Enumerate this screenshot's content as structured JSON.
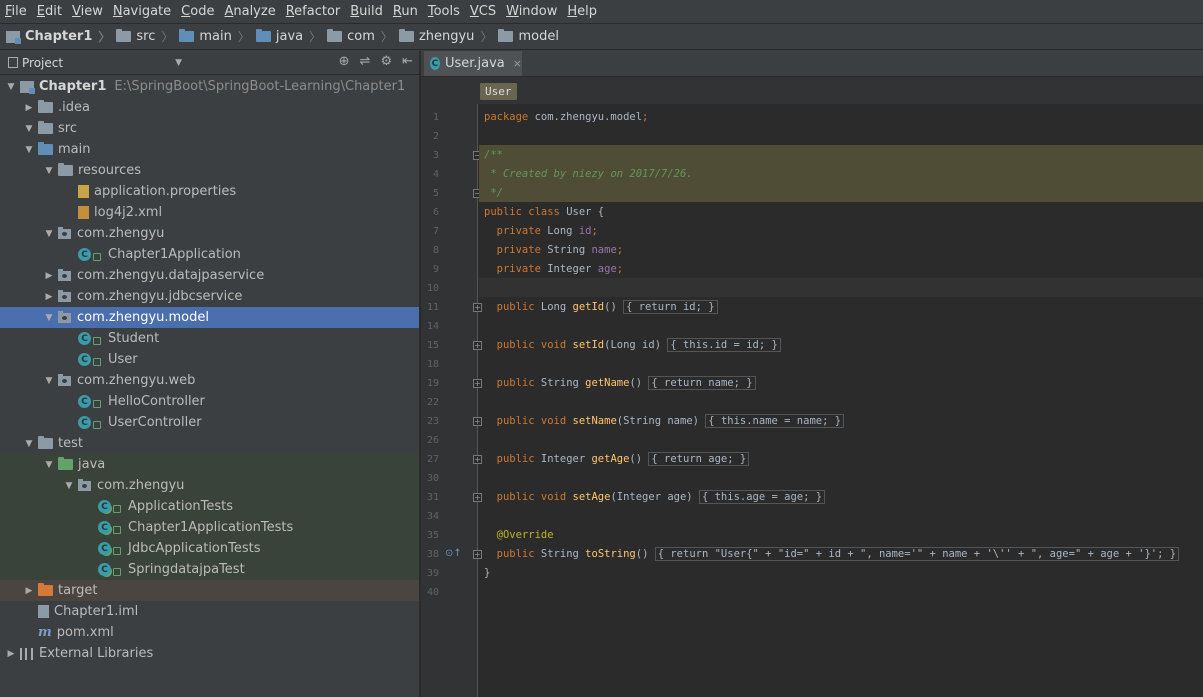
{
  "menu": [
    "File",
    "Edit",
    "View",
    "Navigate",
    "Code",
    "Analyze",
    "Refactor",
    "Build",
    "Run",
    "Tools",
    "VCS",
    "Window",
    "Help"
  ],
  "nav": {
    "items": [
      "Chapter1",
      "src",
      "main",
      "java",
      "com",
      "zhengyu",
      "model"
    ]
  },
  "project_panel": {
    "title": "Project",
    "tools": [
      "⊕",
      "⇌",
      "⚙",
      "⇤"
    ]
  },
  "tree": [
    {
      "label": "Chapter1",
      "path": "E:\\SpringBoot\\SpringBoot-Learning\\Chapter1",
      "icon": "module-icon",
      "depth": 0,
      "expanded": true,
      "bold": true
    },
    {
      "label": ".idea",
      "icon": "folder-icon",
      "depth": 1,
      "expanded": false
    },
    {
      "label": "src",
      "icon": "folder-icon",
      "depth": 1,
      "expanded": true
    },
    {
      "label": "main",
      "icon": "source-folder-icon",
      "depth": 2,
      "expanded": true
    },
    {
      "label": "resources",
      "icon": "resources-folder-icon",
      "depth": 3,
      "expanded": true
    },
    {
      "label": "application.properties",
      "icon": "properties-file-icon",
      "depth": 4,
      "expanded": null
    },
    {
      "label": "log4j2.xml",
      "icon": "xml-file-icon",
      "depth": 4,
      "expanded": null
    },
    {
      "label": "com.zhengyu",
      "icon": "package-icon",
      "depth": 3,
      "expanded": true
    },
    {
      "label": "Chapter1Application",
      "icon": "class-icon",
      "depth": 4,
      "expanded": null
    },
    {
      "label": "com.zhengyu.datajpaservice",
      "icon": "package-icon",
      "depth": 3,
      "expanded": false
    },
    {
      "label": "com.zhengyu.jdbcservice",
      "icon": "package-icon",
      "depth": 3,
      "expanded": false
    },
    {
      "label": "com.zhengyu.model",
      "icon": "package-icon",
      "depth": 3,
      "expanded": true,
      "selected": true
    },
    {
      "label": "Student",
      "icon": "class-icon",
      "depth": 4,
      "expanded": null
    },
    {
      "label": "User",
      "icon": "class-icon",
      "depth": 4,
      "expanded": null
    },
    {
      "label": "com.zhengyu.web",
      "icon": "package-icon",
      "depth": 3,
      "expanded": true
    },
    {
      "label": "HelloController",
      "icon": "class-icon",
      "depth": 4,
      "expanded": null
    },
    {
      "label": "UserController",
      "icon": "class-icon",
      "depth": 4,
      "expanded": null
    },
    {
      "label": "test",
      "icon": "folder-icon",
      "depth": 2,
      "expanded": true
    },
    {
      "label": "java",
      "icon": "test-folder-icon",
      "depth": 3,
      "expanded": true,
      "band": "test"
    },
    {
      "label": "com.zhengyu",
      "icon": "package-icon",
      "depth": 4,
      "expanded": true,
      "band": "test"
    },
    {
      "label": "ApplicationTests",
      "icon": "test-class-icon",
      "depth": 5,
      "expanded": null,
      "band": "test"
    },
    {
      "label": "Chapter1ApplicationTests",
      "icon": "test-class-icon",
      "depth": 5,
      "expanded": null,
      "band": "test"
    },
    {
      "label": "JdbcApplicationTests",
      "icon": "test-class-icon",
      "depth": 5,
      "expanded": null,
      "band": "test"
    },
    {
      "label": "SpringdatajpaTest",
      "icon": "test-class-icon",
      "depth": 5,
      "expanded": null,
      "band": "test"
    },
    {
      "label": "target",
      "icon": "excluded-folder-icon",
      "depth": 1,
      "expanded": false,
      "band": "excluded"
    },
    {
      "label": "Chapter1.iml",
      "icon": "iml-file-icon",
      "depth": 1,
      "expanded": null
    },
    {
      "label": "pom.xml",
      "icon": "maven-icon",
      "depth": 1,
      "expanded": null
    },
    {
      "label": "External Libraries",
      "icon": "library-icon",
      "depth": 0,
      "expanded": false
    }
  ],
  "editor": {
    "tab_label": "User.java",
    "tab_close": "×",
    "breadcrumb": "User",
    "line_numbers": [
      "1",
      "2",
      "3",
      "4",
      "5",
      "6",
      "7",
      "8",
      "9",
      "10",
      "11",
      "14",
      "15",
      "18",
      "19",
      "22",
      "23",
      "26",
      "27",
      "30",
      "31",
      "34",
      "35",
      "38",
      "39",
      "40"
    ],
    "lines": [
      [
        [
          "kw",
          "package "
        ],
        [
          "",
          "com.zhengyu.model"
        ],
        [
          "kw",
          ";"
        ]
      ],
      [],
      [
        [
          "cmt",
          "/**"
        ]
      ],
      [
        [
          "cmt",
          " * Created by "
        ],
        [
          "cmt",
          "niezy"
        ],
        [
          "cmt",
          " on 2017/7/26."
        ]
      ],
      [
        [
          "cmt",
          " */"
        ]
      ],
      [
        [
          "kw",
          "public class "
        ],
        [
          "",
          "User {"
        ]
      ],
      [
        [
          "kw",
          "  private "
        ],
        [
          "",
          "Long "
        ],
        [
          "fld",
          "id"
        ],
        [
          "kw",
          ";"
        ]
      ],
      [
        [
          "kw",
          "  private "
        ],
        [
          "",
          "String "
        ],
        [
          "fld",
          "name"
        ],
        [
          "kw",
          ";"
        ]
      ],
      [
        [
          "kw",
          "  private "
        ],
        [
          "",
          "Integer "
        ],
        [
          "fld",
          "age"
        ],
        [
          "kw",
          ";"
        ]
      ],
      [],
      [
        [
          "kw",
          "  public "
        ],
        [
          "",
          "Long "
        ],
        [
          "mth",
          "getId"
        ],
        [
          "",
          "() "
        ],
        [
          "fold",
          "{ return id; }"
        ]
      ],
      [],
      [
        [
          "kw",
          "  public void "
        ],
        [
          "mth",
          "setId"
        ],
        [
          "",
          "(Long id) "
        ],
        [
          "fold",
          "{ this.id = id; }"
        ]
      ],
      [],
      [
        [
          "kw",
          "  public "
        ],
        [
          "",
          "String "
        ],
        [
          "mth",
          "getName"
        ],
        [
          "",
          "() "
        ],
        [
          "fold",
          "{ return name; }"
        ]
      ],
      [],
      [
        [
          "kw",
          "  public void "
        ],
        [
          "mth",
          "setName"
        ],
        [
          "",
          "(String name) "
        ],
        [
          "fold",
          "{ this.name = name; }"
        ]
      ],
      [],
      [
        [
          "kw",
          "  public "
        ],
        [
          "",
          "Integer "
        ],
        [
          "mth",
          "getAge"
        ],
        [
          "",
          "() "
        ],
        [
          "fold",
          "{ return age; }"
        ]
      ],
      [],
      [
        [
          "kw",
          "  public void "
        ],
        [
          "mth",
          "setAge"
        ],
        [
          "",
          "(Integer age) "
        ],
        [
          "fold",
          "{ this.age = age; }"
        ]
      ],
      [],
      [
        [
          "ann",
          "  @Override"
        ]
      ],
      [
        [
          "kw",
          "  public "
        ],
        [
          "",
          "String "
        ],
        [
          "mth",
          "toString"
        ],
        [
          "",
          "() "
        ],
        [
          "fold",
          "{ return \"User{\" + \"id=\" + id + \", name='\" + name + '\\'' + \", age=\" + age + '}'; }"
        ]
      ],
      [
        [
          "",
          "}"
        ]
      ],
      []
    ]
  },
  "colors": {
    "background": "#3c3f41",
    "editor_bg": "#2b2b2b",
    "selection": "#4b6eaf",
    "keyword": "#cc7832",
    "field": "#9876aa",
    "comment": "#629755",
    "method": "#ffc66d",
    "annotation": "#bbb529"
  }
}
